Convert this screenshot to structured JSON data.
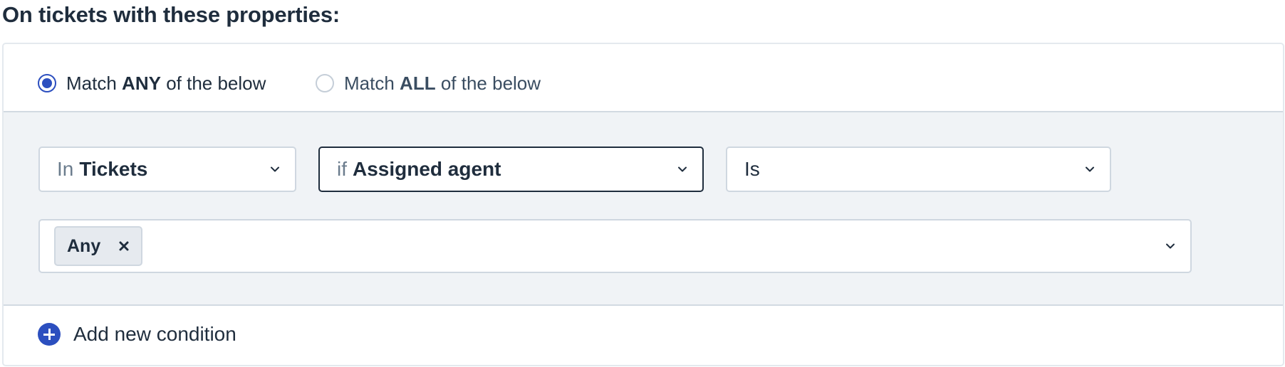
{
  "heading": "On tickets with these properties:",
  "match": {
    "any": {
      "prefix": "Match",
      "keyword": "ANY",
      "suffix": "of the below",
      "selected": true
    },
    "all": {
      "prefix": "Match",
      "keyword": "ALL",
      "suffix": "of the below",
      "selected": false
    }
  },
  "condition": {
    "module": {
      "prefix": "In",
      "value": "Tickets"
    },
    "field": {
      "prefix": "if",
      "value": "Assigned agent"
    },
    "operator": {
      "value": "Is"
    },
    "values": [
      {
        "label": "Any"
      }
    ]
  },
  "add_condition": {
    "label": "Add new condition"
  },
  "colors": {
    "accent": "#2c4fbf",
    "text": "#1f2d3d",
    "muted": "#6b7c8d",
    "conditions_bg": "#f0f3f6",
    "border": "#cfd7e0"
  },
  "icons": {
    "chevron": "chevron-down-icon",
    "remove": "close-icon",
    "add": "plus-circle-icon"
  }
}
